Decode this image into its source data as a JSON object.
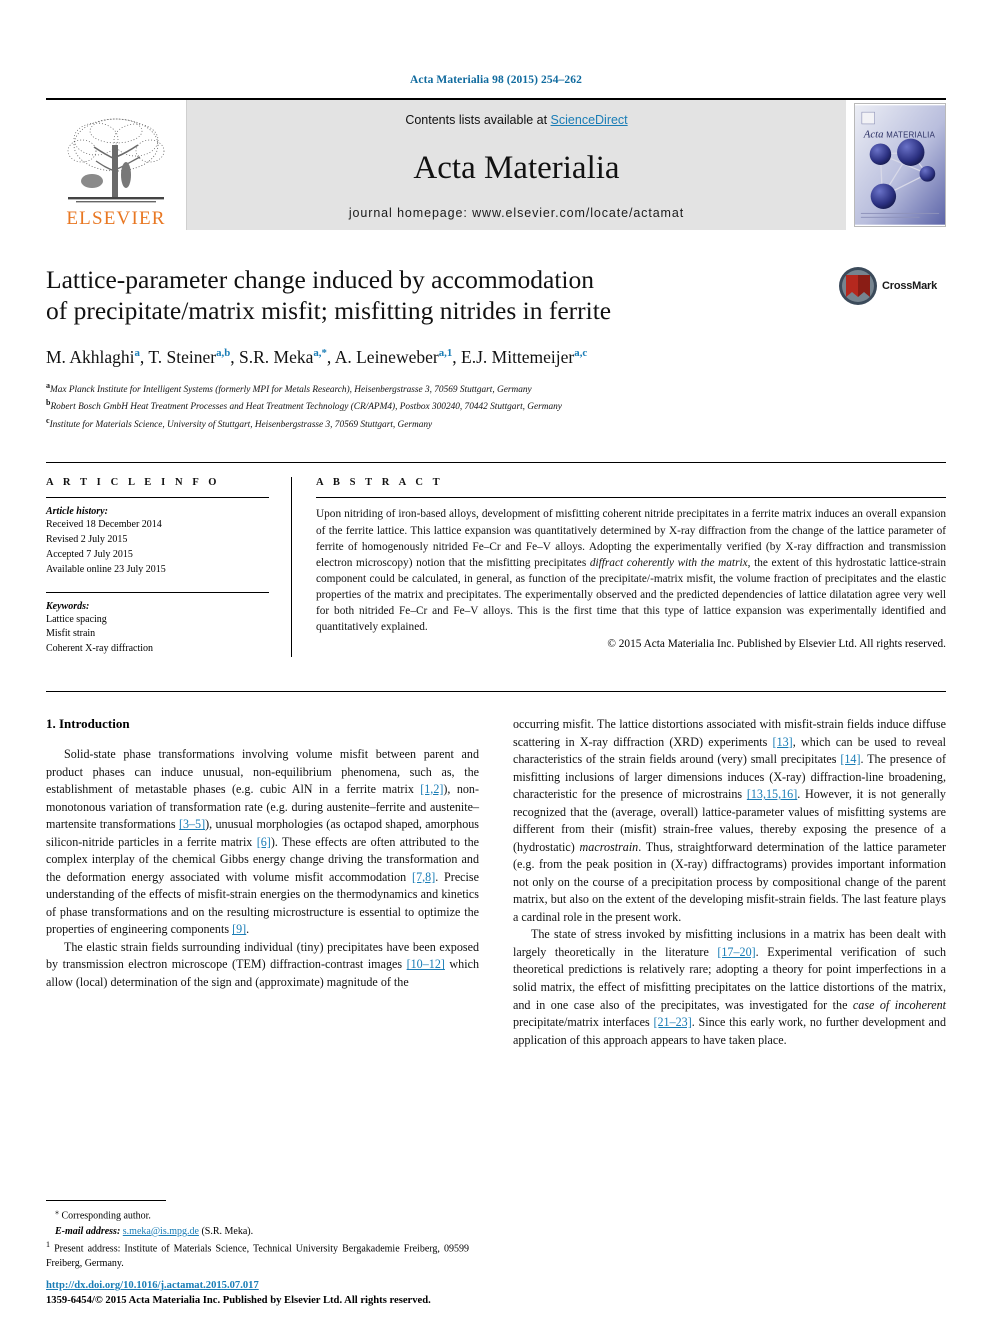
{
  "running_head": "Acta Materialia 98 (2015) 254–262",
  "masthead": {
    "publisher_name": "ELSEVIER",
    "contents_prefix": "Contents lists available at ",
    "contents_link": "ScienceDirect",
    "journal_title": "Acta Materialia",
    "homepage": "journal homepage: www.elsevier.com/locate/actamat",
    "cover_title_italic": "Acta",
    "cover_title_caps": "MATERIALIA"
  },
  "article": {
    "title_line1": "Lattice-parameter change induced by accommodation",
    "title_line2": "of precipitate/matrix misfit; misfitting nitrides in ferrite",
    "crossmark_label": "CrossMark",
    "authors": [
      {
        "name": "M. Akhlaghi",
        "marks": "a"
      },
      {
        "name": "T. Steiner",
        "marks": "a,b"
      },
      {
        "name": "S.R. Meka",
        "marks": "a,*"
      },
      {
        "name": "A. Leineweber",
        "marks": "a,1"
      },
      {
        "name": "E.J. Mittemeijer",
        "marks": "a,c"
      }
    ],
    "affiliations": [
      {
        "mark": "a",
        "text": "Max Planck Institute for Intelligent Systems (formerly MPI for Metals Research), Heisenbergstrasse 3, 70569 Stuttgart, Germany"
      },
      {
        "mark": "b",
        "text": "Robert Bosch GmbH Heat Treatment Processes and Heat Treatment Technology (CR/APM4), Postbox 300240, 70442 Stuttgart, Germany"
      },
      {
        "mark": "c",
        "text": "Institute for Materials Science, University of Stuttgart, Heisenbergstrasse 3, 70569 Stuttgart, Germany"
      }
    ]
  },
  "article_info": {
    "heading": "A R T I C L E    I N F O",
    "history_label": "Article history:",
    "history": [
      "Received 18 December 2014",
      "Revised 2 July 2015",
      "Accepted 7 July 2015",
      "Available online 23 July 2015"
    ],
    "keywords_label": "Keywords:",
    "keywords": [
      "Lattice spacing",
      "Misfit strain",
      "Coherent X-ray diffraction"
    ]
  },
  "abstract": {
    "heading": "A B S T R A C T",
    "part1": "Upon nitriding of iron-based alloys, development of misfitting coherent nitride precipitates in a ferrite matrix induces an overall expansion of the ferrite lattice. This lattice expansion was quantitatively determined by X-ray diffraction from the change of the lattice parameter of ferrite of homogenously nitrided Fe–Cr and Fe–V alloys. Adopting the experimentally verified (by X-ray diffraction and transmission electron microscopy) notion that the misfitting precipitates ",
    "italic1": "diffract coherently with the matrix",
    "part2": ", the extent of this hydrostatic lattice-strain component could be calculated, in general, as function of the precipitate/-matrix misfit, the volume fraction of precipitates and the elastic properties of the matrix and precipitates. The experimentally observed and the predicted dependencies of lattice dilatation agree very well for both nitrided Fe–Cr and Fe–V alloys. This is the first time that this type of lattice expansion was experimentally identified and quantitatively explained.",
    "copyright": "© 2015 Acta Materialia Inc. Published by Elsevier Ltd. All rights reserved."
  },
  "body": {
    "section_heading": "1. Introduction",
    "left_paragraphs": [
      {
        "segments": [
          {
            "t": "Solid-state phase transformations involving volume misfit between parent and product phases can induce unusual, non-equilibrium phenomena, such as, the establishment of metastable phases (e.g. cubic AlN in a ferrite matrix "
          },
          {
            "t": "[1,2]",
            "k": "ref"
          },
          {
            "t": "), non-monotonous variation of transformation rate (e.g. during austenite–ferrite and austenite–martensite transformations "
          },
          {
            "t": "[3–5]",
            "k": "ref"
          },
          {
            "t": "), unusual morphologies (as octapod shaped, amorphous silicon-nitride particles in a ferrite matrix "
          },
          {
            "t": "[6]",
            "k": "ref"
          },
          {
            "t": "). These effects are often attributed to the complex interplay of the chemical Gibbs energy change driving the transformation and the deformation energy associated with volume misfit accommodation "
          },
          {
            "t": "[7,8]",
            "k": "ref"
          },
          {
            "t": ". Precise understanding of the effects of misfit-strain energies on the thermodynamics and kinetics of phase transformations and on the resulting microstructure is essential to optimize the properties of engineering components "
          },
          {
            "t": "[9]",
            "k": "ref"
          },
          {
            "t": "."
          }
        ]
      },
      {
        "segments": [
          {
            "t": "The elastic strain fields surrounding individual (tiny) precipitates have been exposed by transmission electron microscope (TEM) diffraction-contrast images "
          },
          {
            "t": "[10–12]",
            "k": "ref"
          },
          {
            "t": " which allow (local) determination of the sign and (approximate) magnitude of the"
          }
        ]
      }
    ],
    "right_paragraphs": [
      {
        "no_indent": true,
        "segments": [
          {
            "t": "occurring misfit. The lattice distortions associated with misfit-strain fields induce diffuse scattering in X-ray diffraction (XRD) experiments "
          },
          {
            "t": "[13]",
            "k": "ref"
          },
          {
            "t": ", which can be used to reveal characteristics of the strain fields around (very) small precipitates "
          },
          {
            "t": "[14]",
            "k": "ref"
          },
          {
            "t": ". The presence of misfitting inclusions of larger dimensions induces (X-ray) diffraction-line broadening, characteristic for the presence of microstrains "
          },
          {
            "t": "[13,15,16]",
            "k": "ref"
          },
          {
            "t": ". However, it is not generally recognized that the (average, overall) lattice-parameter values of misfitting systems are different from their (misfit) strain-free values, thereby exposing the presence of a (hydrostatic) "
          },
          {
            "t": "macrostrain",
            "k": "it"
          },
          {
            "t": ". Thus, straightforward determination of the lattice parameter (e.g. from the peak position in (X-ray) diffractograms) provides important information not only on the course of a precipitation process by compositional change of the parent matrix, but also on the extent of the developing misfit-strain fields. The last feature plays a cardinal role in the present work."
          }
        ]
      },
      {
        "segments": [
          {
            "t": "The state of stress invoked by misfitting inclusions in a matrix has been dealt with largely theoretically in the literature "
          },
          {
            "t": "[17–20]",
            "k": "ref"
          },
          {
            "t": ". Experimental verification of such theoretical predictions is relatively rare; adopting a theory for point imperfections in a solid matrix, the effect of misfitting precipitates on the lattice distortions of the matrix, and in one case also of the precipitates, was investigated for the "
          },
          {
            "t": "case of incoherent",
            "k": "it"
          },
          {
            "t": " precipitate/matrix interfaces "
          },
          {
            "t": "[21–23]",
            "k": "ref"
          },
          {
            "t": ". Since this early work, no further development and application of this approach appears to have taken place."
          }
        ]
      }
    ]
  },
  "footnotes": {
    "corresponding": "Corresponding author.",
    "corresponding_mark": "⁎",
    "email_label": "E-mail address:",
    "email": "s.meka@is.mpg.de",
    "email_suffix": "(S.R. Meka).",
    "present_mark": "1",
    "present_address": "Present address: Institute of Materials Science, Technical University Bergakademie Freiberg, 09599 Freiberg, Germany."
  },
  "footer": {
    "doi": "http://dx.doi.org/10.1016/j.actamat.2015.07.017",
    "issn_line": "1359-6454/© 2015 Acta Materialia Inc. Published by Elsevier Ltd. All rights reserved."
  },
  "colors": {
    "link_blue": "#1a7db6",
    "running_head_blue": "#0f6a9e",
    "elsevier_orange": "#e87722",
    "panel_gray": "#e3e3e3",
    "crossmark_red": "#b5281e"
  }
}
